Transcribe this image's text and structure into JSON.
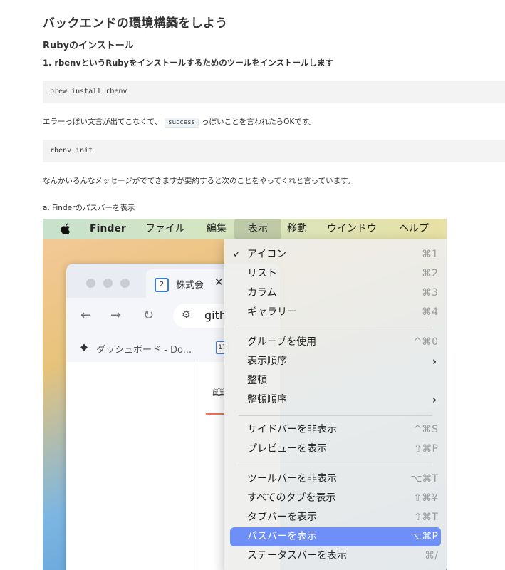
{
  "article": {
    "title": "バックエンドの環境構築をしよう",
    "subtitle": "Rubyのインストール",
    "step1": "1. rbenvというRubyをインストールするためのツールをインストールします",
    "code1": "brew install rbenv",
    "para1_before": "エラーっぽい文言が出てこなくて、",
    "para1_code": "success",
    "para1_after": "っぽいことを言われたらOKです。",
    "code2": "rbenv init",
    "para2": "なんかいろんなメッセージがでてきますが要約すると次のことをやってくれと言っています。",
    "step_a": "a. Finderのパスバーを表示"
  },
  "screenshot": {
    "menubar": {
      "app": "Finder",
      "items": [
        "ファイル",
        "編集",
        "表示",
        "移動",
        "ウインドウ",
        "ヘルプ"
      ],
      "active": "表示"
    },
    "browser": {
      "tab_icon": "2",
      "tab_text": "株式会",
      "address_partial": "gith",
      "bookmark_text": "ダッシュボード - Do...",
      "bookmark_icon": "17"
    },
    "menu": {
      "items": [
        {
          "label": "アイコン",
          "shortcut": "⌘1",
          "checked": true
        },
        {
          "label": "リスト",
          "shortcut": "⌘2"
        },
        {
          "label": "カラム",
          "shortcut": "⌘3"
        },
        {
          "label": "ギャラリー",
          "shortcut": "⌘4"
        },
        {
          "label": "グループを使用",
          "shortcut": "^⌘0"
        },
        {
          "label": "表示順序",
          "submenu": true
        },
        {
          "label": "整頓"
        },
        {
          "label": "整頓順序",
          "submenu": true
        },
        {
          "label": "サイドバーを非表示",
          "shortcut": "^⌘S"
        },
        {
          "label": "プレビューを表示",
          "shortcut": "⇧⌘P"
        },
        {
          "label": "ツールバーを非表示",
          "shortcut": "⌥⌘T"
        },
        {
          "label": "すべてのタブを表示",
          "shortcut": "⇧⌘¥"
        },
        {
          "label": "タブバーを表示",
          "shortcut": "⇧⌘T"
        },
        {
          "label": "パスバーを表示",
          "shortcut": "⌥⌘P",
          "highlighted": true
        },
        {
          "label": "ステータスバーを表示",
          "shortcut": "⌘/"
        }
      ]
    },
    "colors": {
      "highlight": "#6e8ef8"
    }
  }
}
